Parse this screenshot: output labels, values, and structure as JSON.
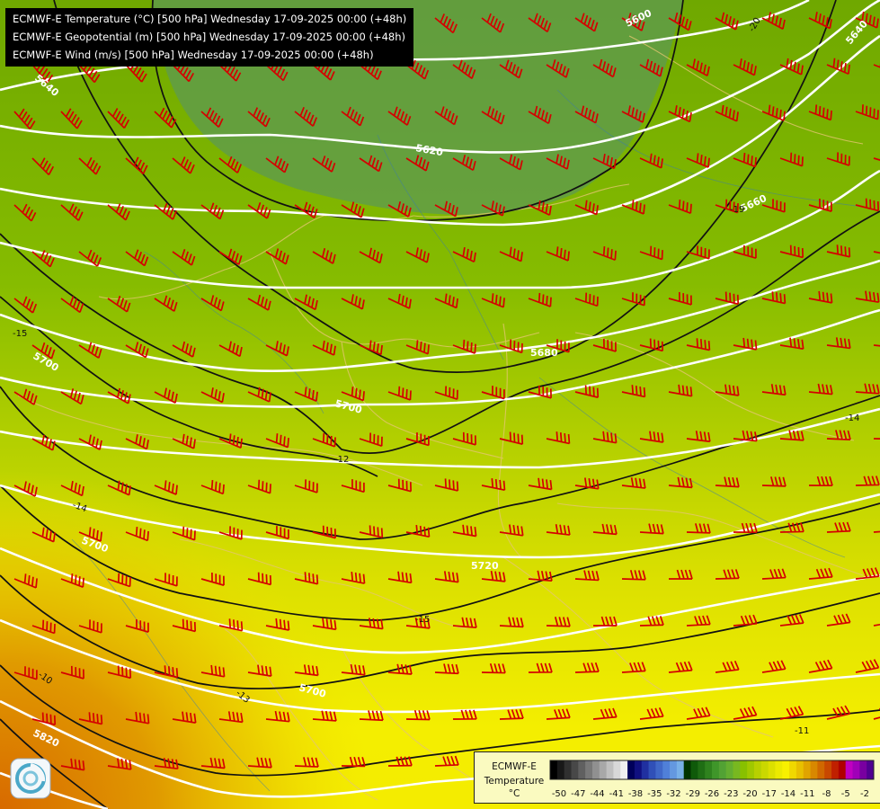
{
  "titles": [
    "ECMWF-E Temperature (°C) [500 hPa] Wednesday 17-09-2025 00:00 (+48h)",
    "ECMWF-E Geopotential (m) [500 hPa] Wednesday 17-09-2025 00:00 (+48h)",
    "ECMWF-E Wind (m/s) [500 hPa] Wednesday 17-09-2025 00:00 (+48h)"
  ],
  "legend": {
    "model": "ECMWF-E",
    "variable": "Temperature",
    "unit": "°C",
    "colors": [
      "#000000",
      "#181818",
      "#303030",
      "#484848",
      "#606060",
      "#787878",
      "#909090",
      "#a8a8a8",
      "#c0c0c0",
      "#d8d8d8",
      "#f0f0f0",
      "#00005a",
      "#101080",
      "#2030a0",
      "#3050b8",
      "#4068c8",
      "#5080d8",
      "#6498e0",
      "#78b0e8",
      "#003300",
      "#0f5a0a",
      "#1f6e14",
      "#2f821e",
      "#3f962a",
      "#52a234",
      "#64ae30",
      "#78b820",
      "#88c000",
      "#a0c800",
      "#b8d000",
      "#cad800",
      "#dce000",
      "#ecea00",
      "#f8f000",
      "#f0d800",
      "#e8c000",
      "#e0a400",
      "#d88800",
      "#d06800",
      "#c84800",
      "#c02000",
      "#b00000",
      "#c000c0",
      "#a000b8",
      "#7800a0",
      "#500090"
    ],
    "ticks": [
      "-50",
      "-47",
      "-44",
      "-41",
      "-38",
      "-35",
      "-32",
      "-29",
      "-26",
      "-23",
      "-20",
      "-17",
      "-14",
      "-11",
      "-8",
      "-5",
      "-2"
    ]
  },
  "geopotential_labels": [
    "5600",
    "5620",
    "5640",
    "5640",
    "5660",
    "5680",
    "5700",
    "5700",
    "5700",
    "5700",
    "5720",
    "5820"
  ],
  "temperature_labels": [
    "-20",
    "-19",
    "-15",
    "-14",
    "-14",
    "-15",
    "-13",
    "-11",
    "-10",
    "-12"
  ]
}
